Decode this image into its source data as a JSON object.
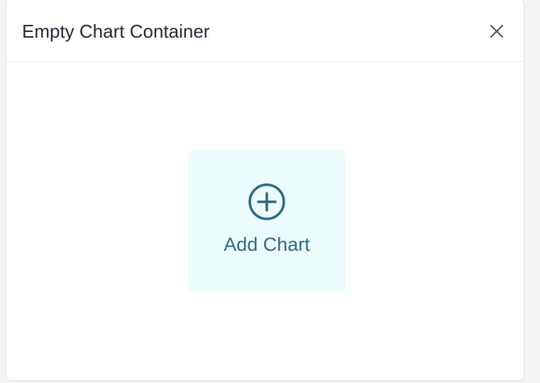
{
  "panel": {
    "title": "Empty Chart Container",
    "close_icon": "close-icon"
  },
  "add_chart": {
    "label": "Add Chart",
    "icon": "plus-circle-icon",
    "accent_color": "#2f6a82",
    "background_color": "#ecfcfd"
  }
}
